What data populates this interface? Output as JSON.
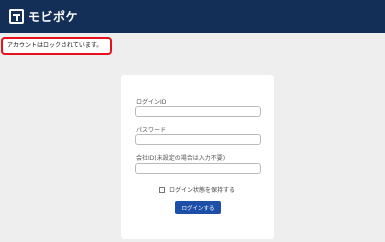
{
  "header": {
    "logo_text": "モビポケ",
    "logo_icon": "mobipoke-logo-icon",
    "background_color": "#142f57"
  },
  "alert": {
    "message": "アカウントはロックされています。",
    "highlight_color": "#e8101a"
  },
  "login_form": {
    "login_id_label": "ログインID",
    "login_id_value": "",
    "password_label": "パスワード",
    "password_value": "",
    "company_id_label": "会社ID(未設定の場合は入力不要)",
    "company_id_value": "",
    "remember_label": "ログイン状態を保持する",
    "remember_checked": false,
    "submit_label": "ログインする",
    "button_color": "#1d4fa8"
  }
}
